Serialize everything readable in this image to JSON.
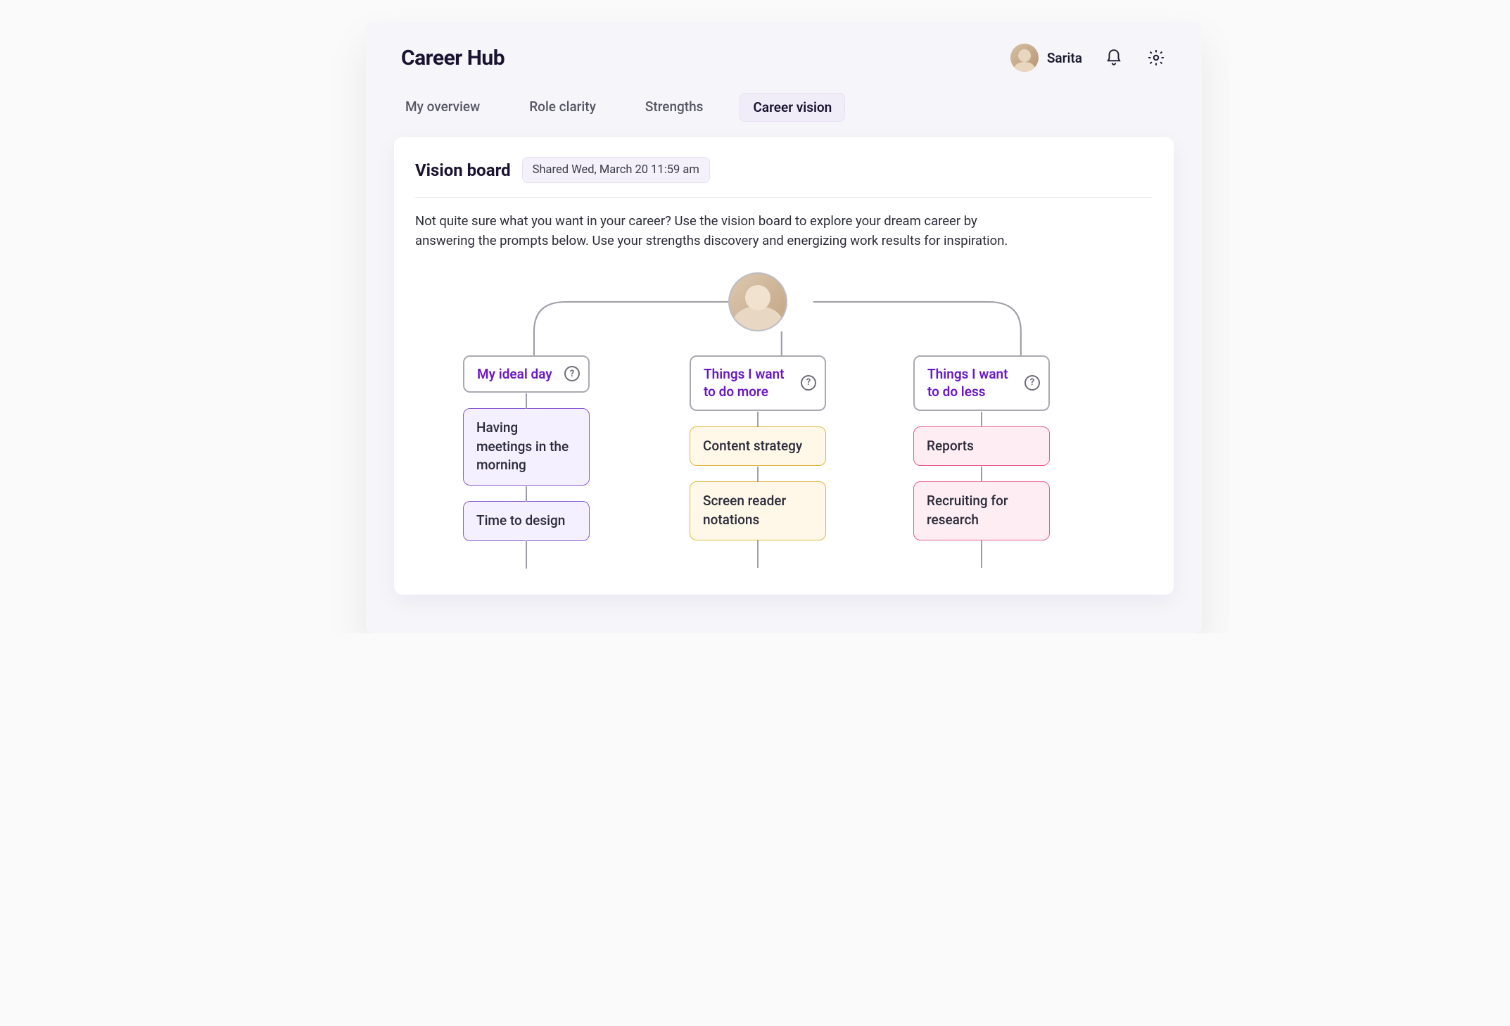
{
  "app_title": "Career Hub",
  "user": {
    "name": "Sarita"
  },
  "tabs": [
    {
      "label": "My overview",
      "active": false
    },
    {
      "label": "Role clarity",
      "active": false
    },
    {
      "label": "Strengths",
      "active": false
    },
    {
      "label": "Career vision",
      "active": true
    }
  ],
  "card": {
    "title": "Vision board",
    "shared_badge": "Shared Wed, March 20 11:59 am",
    "description": "Not quite sure what you want in your career? Use the vision board to explore your dream career by answering the prompts below. Use your strengths discovery and energizing work results for inspiration."
  },
  "board": {
    "columns": [
      {
        "key": "ideal",
        "title": "My ideal day",
        "color": "purple",
        "items": [
          "Having meetings in the morning",
          "Time to design"
        ]
      },
      {
        "key": "more",
        "title": "Things I want to do more",
        "color": "yellow",
        "items": [
          "Content strategy",
          "Screen reader notations"
        ]
      },
      {
        "key": "less",
        "title": "Things I want to do less",
        "color": "pink",
        "items": [
          "Reports",
          "Recruiting for research"
        ]
      }
    ]
  }
}
